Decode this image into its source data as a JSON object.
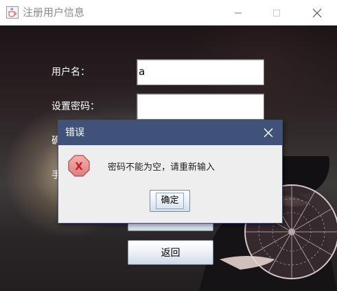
{
  "window": {
    "title": "注册用户信息",
    "icon": "java-cup-icon",
    "controls": [
      "minimize-icon",
      "maximize-icon",
      "close-icon"
    ]
  },
  "form": {
    "username_label": "用户名：",
    "username_value": "a",
    "password_label": "设置密码：",
    "password_value": "",
    "confirm_label_partial": "确",
    "phone_label_partial": "手",
    "back_button": "返回"
  },
  "dialog": {
    "title": "错误",
    "message": "密码不能为空，请重新输入",
    "ok_button": "确定",
    "icon": "error-icon"
  },
  "colors": {
    "dialog_titlebar": "#41527a",
    "error_red": "#d9393a"
  }
}
